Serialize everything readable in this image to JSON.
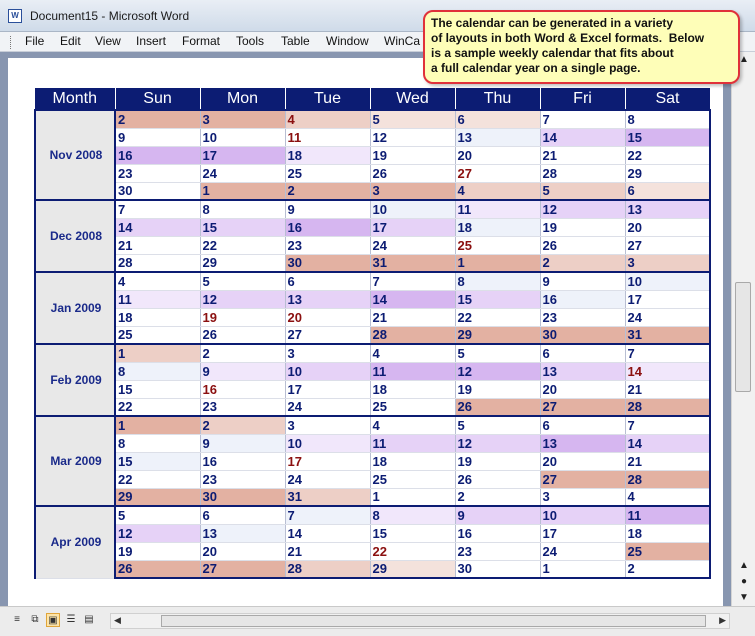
{
  "window": {
    "title": "Document15 - Microsoft Word"
  },
  "menu": [
    "File",
    "Edit",
    "View",
    "Insert",
    "Format",
    "Tools",
    "Table",
    "Window",
    "WinCa"
  ],
  "callout": {
    "lines": [
      "The calendar can be generated in a variety",
      "of layouts in both Word & Excel formats.  Below",
      "is a sample weekly calendar that fits about",
      "a full calendar year on a single page."
    ]
  },
  "calendar": {
    "headers": [
      "Month",
      "Sun",
      "Mon",
      "Tue",
      "Wed",
      "Thu",
      "Fri",
      "Sat"
    ],
    "months": [
      {
        "label": "Nov 2008",
        "weeks": [
          [
            [
              "2",
              1
            ],
            [
              "3",
              1
            ],
            [
              "4",
              2,
              1
            ],
            [
              "5",
              3
            ],
            [
              "6",
              3
            ],
            [
              "7",
              0
            ],
            [
              "8",
              0
            ]
          ],
          [
            [
              "9",
              0
            ],
            [
              "10",
              0
            ],
            [
              "11",
              0,
              1
            ],
            [
              "12",
              0
            ],
            [
              "13",
              7
            ],
            [
              "14",
              5
            ],
            [
              "15",
              4
            ]
          ],
          [
            [
              "16",
              4
            ],
            [
              "17",
              4
            ],
            [
              "18",
              6
            ],
            [
              "19",
              0
            ],
            [
              "20",
              0
            ],
            [
              "21",
              0
            ],
            [
              "22",
              0
            ]
          ],
          [
            [
              "23",
              0
            ],
            [
              "24",
              0
            ],
            [
              "25",
              0
            ],
            [
              "26",
              0
            ],
            [
              "27",
              0,
              1
            ],
            [
              "28",
              0
            ],
            [
              "29",
              0
            ]
          ],
          [
            [
              "30",
              0
            ],
            [
              "1",
              1
            ],
            [
              "2",
              1
            ],
            [
              "3",
              1
            ],
            [
              "4",
              2
            ],
            [
              "5",
              2
            ],
            [
              "6",
              3
            ]
          ]
        ]
      },
      {
        "label": "Dec 2008",
        "weeks": [
          [
            [
              "7",
              0
            ],
            [
              "8",
              0
            ],
            [
              "9",
              0
            ],
            [
              "10",
              7
            ],
            [
              "11",
              6
            ],
            [
              "12",
              5
            ],
            [
              "13",
              5
            ]
          ],
          [
            [
              "14",
              5
            ],
            [
              "15",
              5
            ],
            [
              "16",
              4
            ],
            [
              "17",
              5
            ],
            [
              "18",
              7
            ],
            [
              "19",
              0
            ],
            [
              "20",
              0
            ]
          ],
          [
            [
              "21",
              0
            ],
            [
              "22",
              0
            ],
            [
              "23",
              0
            ],
            [
              "24",
              0
            ],
            [
              "25",
              0,
              1
            ],
            [
              "26",
              0
            ],
            [
              "27",
              0
            ]
          ],
          [
            [
              "28",
              0
            ],
            [
              "29",
              0
            ],
            [
              "30",
              1
            ],
            [
              "31",
              1
            ],
            [
              "1",
              1
            ],
            [
              "2",
              2
            ],
            [
              "3",
              2
            ]
          ]
        ]
      },
      {
        "label": "Jan 2009",
        "weeks": [
          [
            [
              "4",
              0
            ],
            [
              "5",
              0
            ],
            [
              "6",
              0
            ],
            [
              "7",
              0
            ],
            [
              "8",
              7
            ],
            [
              "9",
              0
            ],
            [
              "10",
              7
            ]
          ],
          [
            [
              "11",
              6
            ],
            [
              "12",
              5
            ],
            [
              "13",
              5
            ],
            [
              "14",
              4
            ],
            [
              "15",
              5
            ],
            [
              "16",
              7
            ],
            [
              "17",
              0
            ]
          ],
          [
            [
              "18",
              0
            ],
            [
              "19",
              0,
              1
            ],
            [
              "20",
              0,
              1
            ],
            [
              "21",
              0
            ],
            [
              "22",
              0
            ],
            [
              "23",
              0
            ],
            [
              "24",
              0
            ]
          ],
          [
            [
              "25",
              0
            ],
            [
              "26",
              0
            ],
            [
              "27",
              0
            ],
            [
              "28",
              1
            ],
            [
              "29",
              1
            ],
            [
              "30",
              1
            ],
            [
              "31",
              1
            ]
          ]
        ]
      },
      {
        "label": "Feb 2009",
        "weeks": [
          [
            [
              "1",
              2
            ],
            [
              "2",
              0
            ],
            [
              "3",
              0
            ],
            [
              "4",
              0
            ],
            [
              "5",
              0
            ],
            [
              "6",
              0
            ],
            [
              "7",
              0
            ]
          ],
          [
            [
              "8",
              7
            ],
            [
              "9",
              6
            ],
            [
              "10",
              5
            ],
            [
              "11",
              4
            ],
            [
              "12",
              4
            ],
            [
              "13",
              5
            ],
            [
              "14",
              6,
              1
            ]
          ],
          [
            [
              "15",
              0
            ],
            [
              "16",
              0,
              1
            ],
            [
              "17",
              0
            ],
            [
              "18",
              0
            ],
            [
              "19",
              0
            ],
            [
              "20",
              0
            ],
            [
              "21",
              0
            ]
          ],
          [
            [
              "22",
              0
            ],
            [
              "23",
              0
            ],
            [
              "24",
              0
            ],
            [
              "25",
              0
            ],
            [
              "26",
              1
            ],
            [
              "27",
              1
            ],
            [
              "28",
              1
            ]
          ]
        ]
      },
      {
        "label": "Mar 2009",
        "weeks": [
          [
            [
              "1",
              1
            ],
            [
              "2",
              2
            ],
            [
              "3",
              0
            ],
            [
              "4",
              0
            ],
            [
              "5",
              0
            ],
            [
              "6",
              0
            ],
            [
              "7",
              0
            ]
          ],
          [
            [
              "8",
              0
            ],
            [
              "9",
              7
            ],
            [
              "10",
              6
            ],
            [
              "11",
              5
            ],
            [
              "12",
              5
            ],
            [
              "13",
              4
            ],
            [
              "14",
              5
            ]
          ],
          [
            [
              "15",
              7
            ],
            [
              "16",
              0
            ],
            [
              "17",
              0,
              1
            ],
            [
              "18",
              0
            ],
            [
              "19",
              0
            ],
            [
              "20",
              0
            ],
            [
              "21",
              0
            ]
          ],
          [
            [
              "22",
              0
            ],
            [
              "23",
              0
            ],
            [
              "24",
              0
            ],
            [
              "25",
              0
            ],
            [
              "26",
              0
            ],
            [
              "27",
              1
            ],
            [
              "28",
              1
            ]
          ],
          [
            [
              "29",
              1
            ],
            [
              "30",
              1
            ],
            [
              "31",
              2
            ],
            [
              "1",
              0
            ],
            [
              "2",
              0
            ],
            [
              "3",
              0
            ],
            [
              "4",
              0
            ]
          ]
        ]
      },
      {
        "label": "Apr 2009",
        "weeks": [
          [
            [
              "5",
              0
            ],
            [
              "6",
              0
            ],
            [
              "7",
              7
            ],
            [
              "8",
              6
            ],
            [
              "9",
              5
            ],
            [
              "10",
              5
            ],
            [
              "11",
              4
            ]
          ],
          [
            [
              "12",
              5
            ],
            [
              "13",
              7
            ],
            [
              "14",
              0
            ],
            [
              "15",
              0
            ],
            [
              "16",
              0
            ],
            [
              "17",
              0
            ],
            [
              "18",
              0
            ]
          ],
          [
            [
              "19",
              0
            ],
            [
              "20",
              0
            ],
            [
              "21",
              0
            ],
            [
              "22",
              0,
              1
            ],
            [
              "23",
              0
            ],
            [
              "24",
              0
            ],
            [
              "25",
              1
            ]
          ],
          [
            [
              "26",
              1
            ],
            [
              "27",
              1
            ],
            [
              "28",
              2
            ],
            [
              "29",
              3
            ],
            [
              "30",
              0
            ],
            [
              "1",
              0
            ],
            [
              "2",
              0
            ]
          ]
        ]
      }
    ]
  }
}
